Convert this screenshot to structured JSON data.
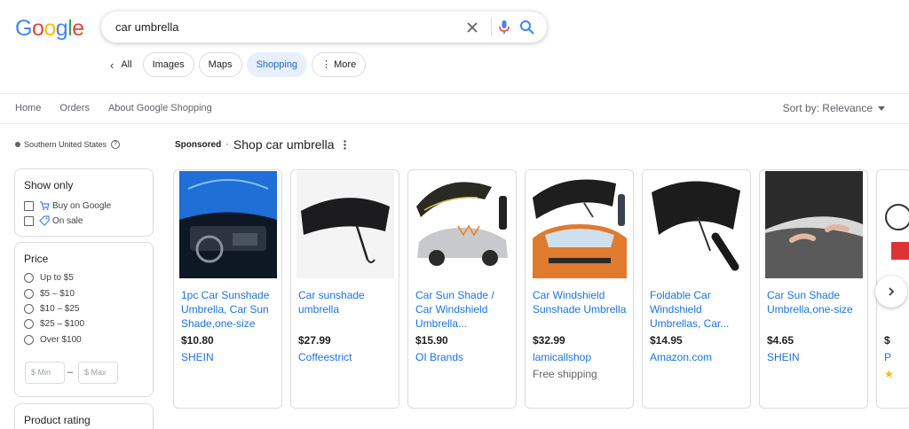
{
  "logo": {
    "letters": [
      "G",
      "o",
      "o",
      "g",
      "l",
      "e"
    ]
  },
  "search": {
    "query": "car umbrella",
    "clear_icon": "close-icon",
    "mic_icon": "mic-icon",
    "search_icon": "search-icon"
  },
  "tabs": {
    "back_label": "All",
    "chips": [
      {
        "label": "Images",
        "active": false
      },
      {
        "label": "Maps",
        "active": false
      },
      {
        "label": "Shopping",
        "active": true
      },
      {
        "label": "⋮ More",
        "active": false
      }
    ]
  },
  "subnav": {
    "items": [
      "Home",
      "Orders",
      "About Google Shopping"
    ],
    "sort_label": "Sort by: Relevance"
  },
  "location": {
    "text": "Southern United States",
    "help": "?"
  },
  "filters": {
    "show_only": {
      "title": "Show only",
      "options": [
        "Buy on Google",
        "On sale"
      ]
    },
    "price": {
      "title": "Price",
      "options": [
        "Up to $5",
        "$5 – $10",
        "$10 – $25",
        "$25 – $100",
        "Over $100"
      ],
      "min_placeholder": "$ Min",
      "max_placeholder": "$ Max",
      "dash": "–"
    },
    "rating": {
      "title": "Product rating"
    }
  },
  "sponsored": {
    "label": "Sponsored",
    "separator": "·",
    "title": "Shop car umbrella"
  },
  "products": [
    {
      "title": "1pc Car Sunshade Umbrella, Car Sun Shade,one-size",
      "price": "$10.80",
      "seller": "SHEIN",
      "shipping": ""
    },
    {
      "title": "Car sunshade umbrella",
      "price": "$27.99",
      "seller": "Coffeestrict",
      "shipping": ""
    },
    {
      "title": "Car Sun Shade / Car Windshield Umbrella...",
      "price": "$15.90",
      "seller": "OI Brands",
      "shipping": ""
    },
    {
      "title": "Car Windshield Sunshade Umbrella",
      "price": "$32.99",
      "seller": "lamicallshop",
      "shipping": "Free shipping"
    },
    {
      "title": "Foldable Car Windshield Umbrellas, Car...",
      "price": "$14.95",
      "seller": "Amazon.com",
      "shipping": ""
    },
    {
      "title": "Car Sun Shade Umbrella,one-size",
      "price": "$4.65",
      "seller": "SHEIN",
      "shipping": ""
    },
    {
      "title": "S S",
      "price": "$",
      "seller": "P",
      "shipping": ""
    }
  ],
  "colors": {
    "link": "#1a73e8",
    "active_chip_bg": "#e8f0fe",
    "active_chip_text": "#1967d2",
    "star": "#fbbc04"
  }
}
